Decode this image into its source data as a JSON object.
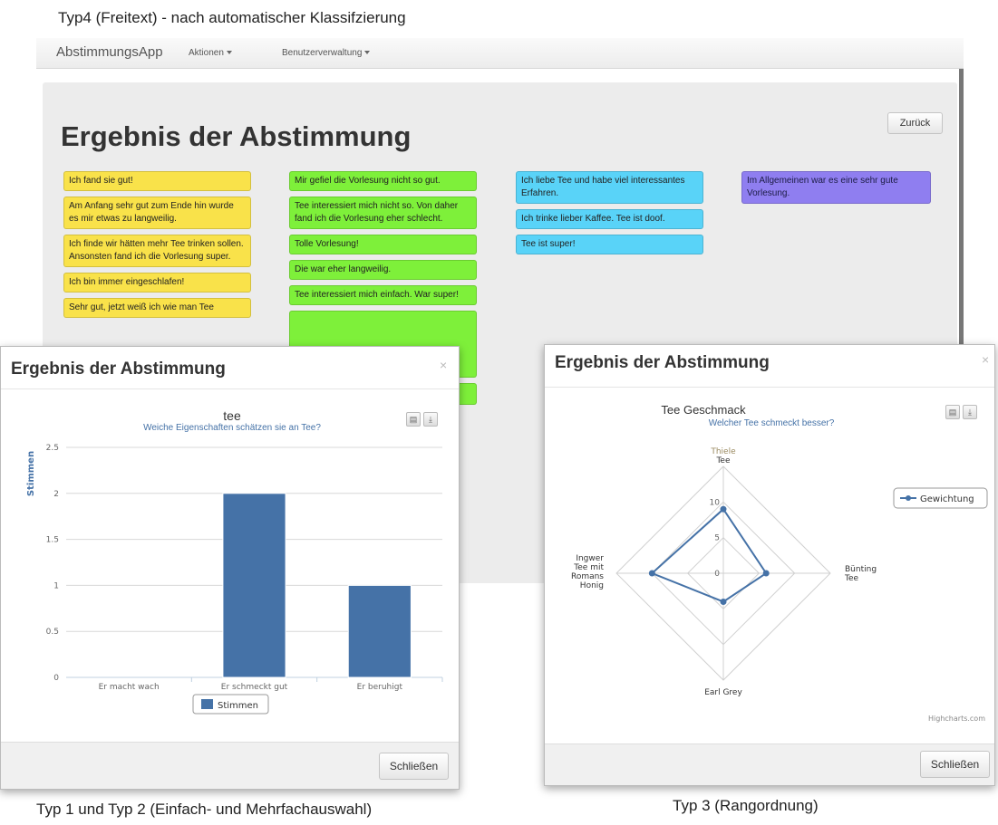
{
  "captions": {
    "top": "Typ4 (Freitext) - nach automatischer Klassifzierung",
    "left": "Typ 1 und Typ 2 (Einfach- und Mehrfachauswahl)",
    "right": "Typ 3 (Rangordnung)"
  },
  "app": {
    "brand": "AbstimmungsApp",
    "menu": [
      "Aktionen",
      "Benutzerverwaltung"
    ],
    "title": "Ergebnis der Abstimmung",
    "back_label": "Zurück",
    "columns": [
      {
        "color": "#f9e24a",
        "items": [
          "Ich fand sie gut!",
          "Am Anfang sehr gut zum Ende hin wurde es mir etwas zu langweilig.",
          "Ich finde wir hätten mehr Tee trinken sollen. Ansonsten fand ich die Vorlesung super.",
          "Ich bin immer eingeschlafen!",
          "Sehr gut, jetzt weiß ich wie man Tee"
        ]
      },
      {
        "color": "#7ef03a",
        "items": [
          "Mir gefiel die Vorlesung nicht so gut.",
          "Tee interessiert mich nicht so. Von daher fand ich die Vorlesung eher schlecht.",
          "Tolle Vorlesung!",
          "Die war eher langweilig.",
          "Tee interessiert mich einfach. War super!"
        ]
      },
      {
        "color": "#59d3f8",
        "items": [
          "Ich liebe Tee und habe viel interessantes Erfahren.",
          "Ich trinke lieber Kaffee. Tee ist doof.",
          "Tee ist super!"
        ]
      },
      {
        "color": "#8f7ef0",
        "items": [
          "Im Allgemeinen war es eine sehr gute Vorlesung."
        ]
      }
    ]
  },
  "modal_left": {
    "title": "Ergebnis der Abstimmung",
    "close_x": "×",
    "close_label": "Schließen",
    "print_icon": "print-icon",
    "download_icon": "download-icon"
  },
  "modal_right": {
    "title": "Ergebnis der Abstimmung",
    "close_x": "×",
    "close_label": "Schließen",
    "credit": "Highcharts.com",
    "print_icon": "print-icon",
    "download_icon": "download-icon"
  },
  "chart_data": [
    {
      "type": "bar",
      "title": "tee",
      "subtitle": "Weiche Eigenschaften schätzen sie an Tee?",
      "xlabel": "",
      "ylabel": "Stimmen",
      "categories": [
        "Er macht wach",
        "Er schmeckt gut",
        "Er beruhigt"
      ],
      "series": [
        {
          "name": "Stimmen",
          "values": [
            0,
            2,
            1
          ]
        }
      ],
      "ylim": [
        0,
        2.5
      ],
      "yticks": [
        "0",
        "0.5",
        "1",
        "1.5",
        "2",
        "2.5"
      ],
      "grid": true,
      "legend": "bottom-center",
      "color": "#4572a7"
    },
    {
      "type": "radar",
      "title": "Tee Geschmack",
      "subtitle": "Welcher Tee schmeckt besser?",
      "categories": [
        "Thiele Tee",
        "Bünting Tee",
        "Earl Grey",
        "Ingwer Tee mit Romans Honig"
      ],
      "series": [
        {
          "name": "Gewichtung",
          "values": [
            9,
            6,
            4,
            10
          ]
        }
      ],
      "ylim": [
        0,
        15
      ],
      "yticks": [
        "0",
        "5",
        "10"
      ],
      "legend": "right",
      "color": "#4572a7"
    }
  ]
}
